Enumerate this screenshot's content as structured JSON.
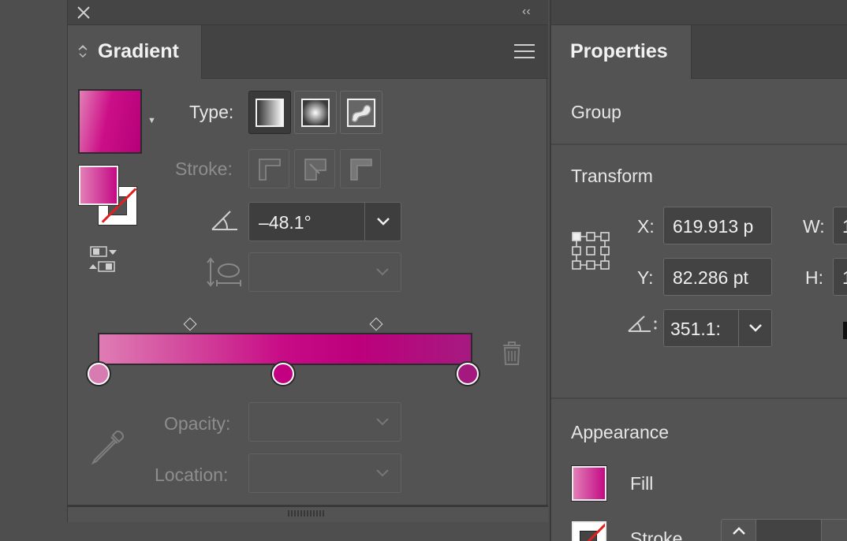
{
  "gradient_panel": {
    "title": "Gradient",
    "type_label": "Type:",
    "type_options": [
      "linear-gradient-icon",
      "radial-gradient-icon",
      "freeform-gradient-icon"
    ],
    "type_selected": "linear",
    "stroke_label": "Stroke:",
    "angle_value": "–48.1°",
    "opacity_label": "Opacity:",
    "location_label": "Location:",
    "gradient_colors": [
      "#df7cb4",
      "#c70a85",
      "#a61a80"
    ],
    "stops": [
      {
        "location": 0,
        "color": "#d77bb0"
      },
      {
        "location": 50,
        "color": "#c40082"
      },
      {
        "location": 100,
        "color": "#a3197e"
      }
    ],
    "midpoints": [
      25,
      75
    ]
  },
  "properties_panel": {
    "title": "Properties",
    "object_type": "Group",
    "transform": {
      "title": "Transform",
      "x_label": "X:",
      "x_value": "619.913 p",
      "y_label": "Y:",
      "y_value": "82.286 pt",
      "w_label": "W:",
      "w_value": "1",
      "h_label": "H:",
      "h_value": "1",
      "angle_value": "351.1:"
    },
    "appearance": {
      "title": "Appearance",
      "fill_label": "Fill",
      "stroke_label": "Stroke"
    }
  }
}
